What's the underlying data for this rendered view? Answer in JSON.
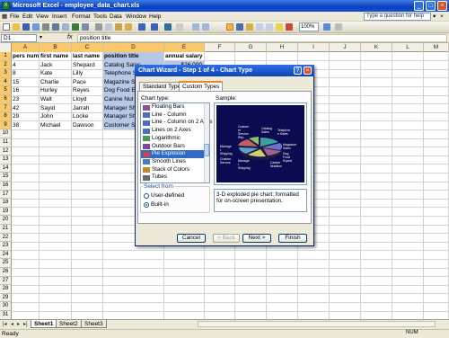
{
  "window": {
    "title": "Microsoft Excel - employee_data_chart.xls",
    "app_icon": "excel-icon"
  },
  "menu": [
    "File",
    "Edit",
    "View",
    "Insert",
    "Format",
    "Tools",
    "Data",
    "Window",
    "Help"
  ],
  "help_search": {
    "placeholder": "Type a question for help"
  },
  "toolbar": {
    "zoom": "100%"
  },
  "formula_bar": {
    "name_box": "D1",
    "fx": "fx",
    "content": "position title"
  },
  "columns": [
    "A",
    "B",
    "C",
    "D",
    "E",
    "F",
    "G",
    "H",
    "I",
    "J",
    "K",
    "L",
    "M"
  ],
  "rows": [
    "1",
    "2",
    "3",
    "4",
    "5",
    "6",
    "7",
    "8",
    "9",
    "10",
    "11",
    "12",
    "13",
    "14",
    "15",
    "16",
    "17",
    "18",
    "19",
    "20",
    "21",
    "22",
    "23",
    "24",
    "25",
    "26",
    "27",
    "28",
    "29",
    "30",
    "31"
  ],
  "table": {
    "headers": [
      "pers num",
      "first name",
      "last name",
      "position title",
      "annual salary"
    ],
    "data": [
      [
        "4",
        "Jack",
        "Shepard",
        "Catalog Sales",
        "$26,000"
      ],
      [
        "8",
        "Kate",
        "Lilly",
        "Telephone S",
        ""
      ],
      [
        "15",
        "Charlie",
        "Pace",
        "Magazine S",
        ""
      ],
      [
        "16",
        "Hurley",
        "Reyes",
        "Dog Food E",
        ""
      ],
      [
        "23",
        "Walt",
        "Lloyd",
        "Canine Nut",
        ""
      ],
      [
        "42",
        "Sayid",
        "Jarrah",
        "Manager Sh",
        ""
      ],
      [
        "29",
        "John",
        "Locke",
        "Manager Sh",
        ""
      ],
      [
        "38",
        "Michael",
        "Dawson",
        "Customer S",
        ""
      ]
    ]
  },
  "sheets": [
    "Sheet1",
    "Sheet2",
    "Sheet3"
  ],
  "active_sheet": "Sheet1",
  "status": {
    "left": "Ready",
    "right": "NUM"
  },
  "dialog": {
    "title": "Chart Wizard - Step 1 of 4 - Chart Type",
    "tabs": [
      "Standard Types",
      "Custom Types"
    ],
    "active_tab": "Custom Types",
    "chart_type_label": "Chart type:",
    "chart_types": [
      "Floating Bars",
      "Line - Column",
      "Line - Column on 2 Axes",
      "Lines on 2 Axes",
      "Logarithmic",
      "Outdoor Bars",
      "Pie Explosion",
      "Smooth Lines",
      "Stack of Colors",
      "Tubes"
    ],
    "selected_chart_type": "Pie Explosion",
    "sample_label": "Sample:",
    "select_from_label": "Select from",
    "select_from_options": [
      "User-defined",
      "Built-in"
    ],
    "select_from_value": "Built-in",
    "description": "3-D exploded pie chart; formatted for on-screen presentation.",
    "sample_slice_labels": [
      "Custom er Service Rep",
      "Catalog Sales",
      "Telephon e Sales",
      "Magazine Sales",
      "Dog Food Expert",
      "Canine Nutrition",
      "Manage r Shipping",
      "Manage r Shipping",
      "Custom Service"
    ],
    "buttons": {
      "cancel": "Cancel",
      "back": "< Back",
      "next": "Next >",
      "finish": "Finish"
    },
    "colors": {
      "selection": "#316ac5",
      "sample_bg": "#0b0b52",
      "title_bar": "#0d43b8"
    }
  }
}
